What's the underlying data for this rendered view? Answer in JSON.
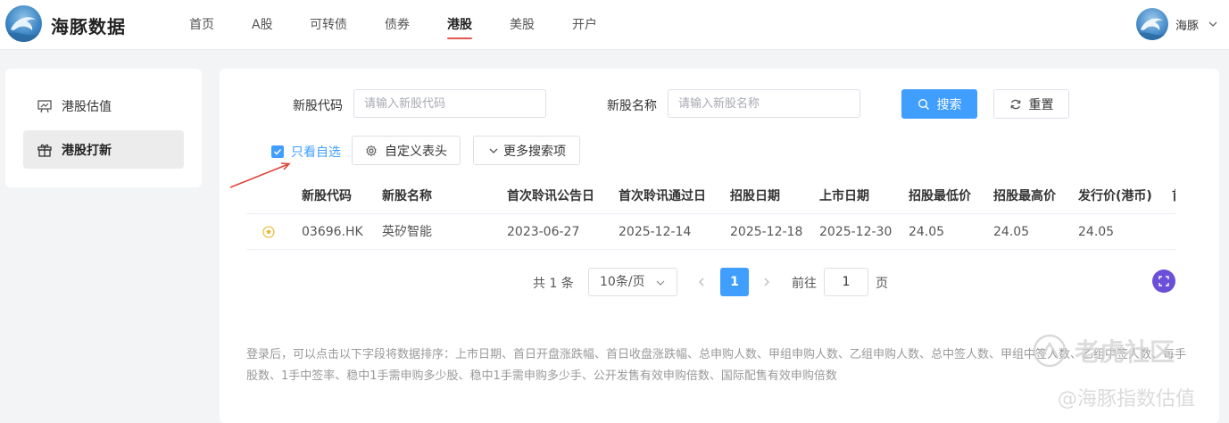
{
  "header": {
    "logo_text": "海豚数据",
    "nav": [
      "首页",
      "A股",
      "可转债",
      "债券",
      "港股",
      "美股",
      "开户"
    ],
    "active_nav": "港股",
    "user_name": "海豚"
  },
  "sidebar": {
    "items": [
      {
        "label": "港股估值",
        "icon": "chart-board-icon",
        "active": false
      },
      {
        "label": "港股打新",
        "icon": "gift-icon",
        "active": true
      }
    ]
  },
  "filters": {
    "code_label": "新股代码",
    "code_placeholder": "请输入新股代码",
    "name_label": "新股名称",
    "name_placeholder": "请输入新股名称",
    "search_label": "搜索",
    "reset_label": "重置",
    "only_watchlist_label": "只看自选",
    "only_watchlist_checked": true,
    "custom_header_label": "自定义表头",
    "more_search_label": "更多搜索项"
  },
  "table": {
    "columns": [
      "新股代码",
      "新股名称",
      "首次聆讯公告日",
      "首次聆讯通过日",
      "招股日期",
      "上市日期",
      "招股最低价",
      "招股最高价",
      "发行价(港币)",
      "首"
    ],
    "rows": [
      {
        "cells": [
          "03696.HK",
          "英矽智能",
          "2023-06-27",
          "2025-12-14",
          "2025-12-18",
          "2025-12-30",
          "24.05",
          "24.05",
          "24.05",
          ""
        ]
      }
    ]
  },
  "pagination": {
    "total_text": "共 1 条",
    "page_size": "10条/页",
    "current_page": "1",
    "goto_label": "前往",
    "goto_value": "1",
    "unit_label": "页"
  },
  "note": "登录后，可以点击以下字段将数据排序：上市日期、首日开盘涨跌幅、首日收盘涨跌幅、总申购人数、甲组申购人数、乙组申购人数、总中签人数、甲组中签人数、乙组中签人数、每手股数、1手中签率、稳中1手需申购多少股、稳中1手需申购多少手、公开发售有效申购倍数、国际配售有效申购倍数",
  "watermark": {
    "line1": "老虎社区",
    "line2": "@海豚指数估值"
  },
  "colors": {
    "accent": "#409eff",
    "nav_underline": "#e4574e",
    "arrow": "#e0463c",
    "fullscreen_button": "#6b4fd8"
  }
}
